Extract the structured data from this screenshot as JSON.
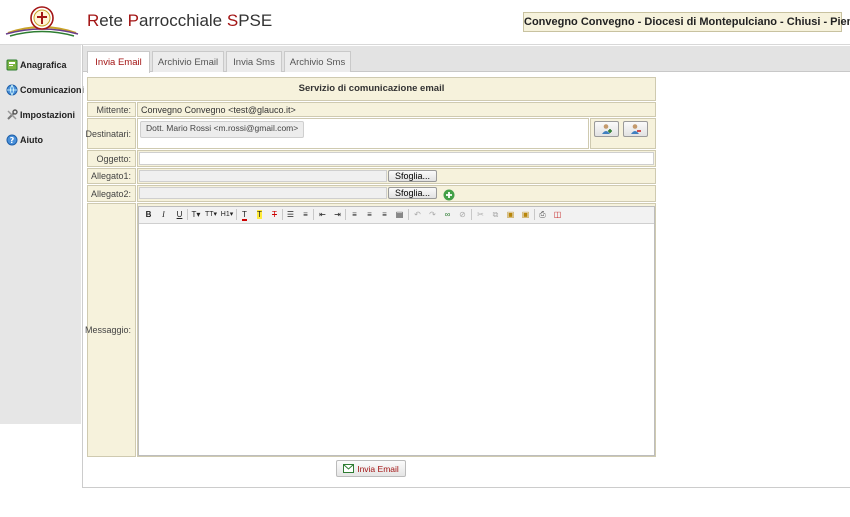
{
  "header": {
    "brand": {
      "r1": "R",
      "w1": "ete ",
      "r2": "P",
      "w2": "arrocchiale ",
      "r3": "S",
      "w3": "PSE"
    },
    "info": "Convegno Convegno  -  Diocesi di Montepulciano - Chiusi - Pienza"
  },
  "sidebar": {
    "items": [
      {
        "label": "Anagrafica",
        "icon": "address-book-icon"
      },
      {
        "label": "Comunicazioni",
        "icon": "globe-icon"
      },
      {
        "label": "Impostazioni",
        "icon": "tools-icon"
      },
      {
        "label": "Aiuto",
        "icon": "help-icon"
      }
    ]
  },
  "tabs": [
    {
      "label": "Invia Email",
      "active": true
    },
    {
      "label": "Archivio Email",
      "active": false
    },
    {
      "label": "Invia Sms",
      "active": false
    },
    {
      "label": "Archivio Sms",
      "active": false
    }
  ],
  "form": {
    "title": "Servizio di comunicazione email",
    "mittente_label": "Mittente:",
    "mittente_value": "Convegno Convegno <test@glauco.it>",
    "destinatari_label": "Destinatari:",
    "destinatari_chip": "Dott. Mario Rossi <m.rossi@gmail.com>",
    "oggetto_label": "Oggetto:",
    "oggetto_value": "",
    "allegato1_label": "Allegato1:",
    "allegato2_label": "Allegato2:",
    "browse_label": "Sfoglia...",
    "messaggio_label": "Messaggio:",
    "send_label": "Invia Email"
  },
  "colors": {
    "accent": "#a31515",
    "panel": "#f6f2dc"
  }
}
